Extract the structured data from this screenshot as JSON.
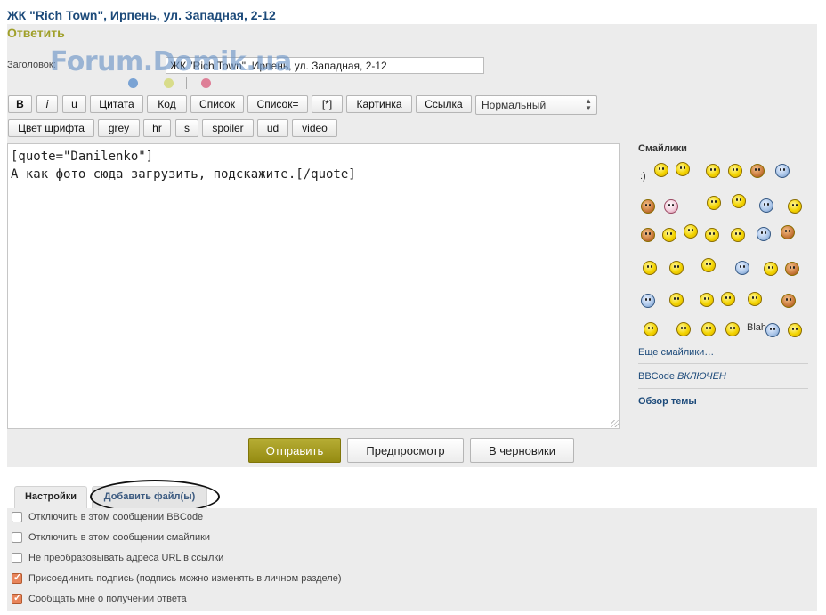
{
  "page": {
    "topic_title": "ЖК \"Rich Town\", Ирпень, ул. Западная, 2-12",
    "reply_heading": "Ответить",
    "watermark": "Forum.Domik.ua"
  },
  "subject": {
    "label": "Заголовок:",
    "value": "ЖК \"Rich Town\", Ирпень, ул. Западная, 2-12"
  },
  "toolbar": {
    "row1": [
      "B",
      "i",
      "u",
      "Цитата",
      "Код",
      "Список",
      "Список=",
      "[*]",
      "Картинка",
      "Ссылка"
    ],
    "row2": [
      "Цвет шрифта",
      "grey",
      "hr",
      "s",
      "spoiler",
      "ud",
      "video"
    ],
    "font_size_select": "Нормальный"
  },
  "editor": {
    "line1": "[quote=\"Danilenko\"]",
    "line2": "А как фото сюда загрузить, подскажите.[/quote]"
  },
  "sidebar": {
    "smilies_title": "Смайлики",
    "smile_text_1": ":)",
    "smile_text_2": "Blah",
    "more_smilies": "Еще смайлики…",
    "bbcode_label": "BBCode",
    "bbcode_state": "ВКЛЮЧЕН",
    "topic_review": "Обзор темы"
  },
  "actions": {
    "submit": "Отправить",
    "preview": "Предпросмотр",
    "draft": "В черновики"
  },
  "tabs": {
    "settings": "Настройки",
    "attach": "Добавить файл(ы)"
  },
  "options": [
    {
      "label": "Отключить в этом сообщении BBCode",
      "checked": false
    },
    {
      "label": "Отключить в этом сообщении смайлики",
      "checked": false
    },
    {
      "label": "Не преобразовывать адреса URL в ссылки",
      "checked": false
    },
    {
      "label": "Присоединить подпись (подпись можно изменять в личном разделе)",
      "checked": true
    },
    {
      "label": "Сообщать мне о получении ответа",
      "checked": true
    }
  ],
  "colors": {
    "accent": "#a0a02a",
    "primary_button": "#a39a1e",
    "title": "#1c4a7a"
  }
}
